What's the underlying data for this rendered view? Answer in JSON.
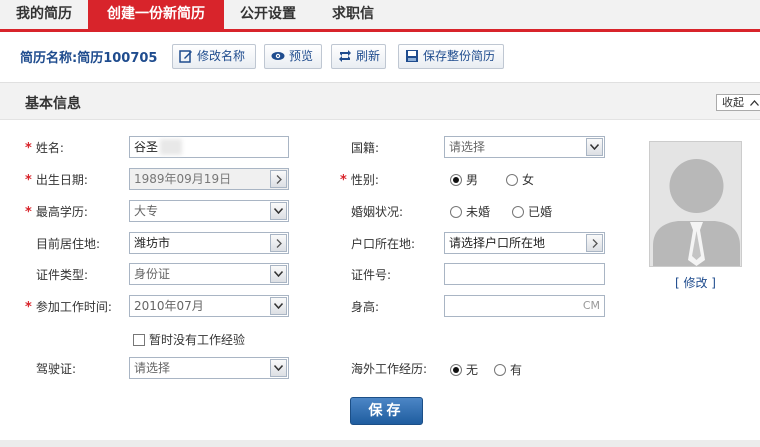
{
  "nav": {
    "tabs": [
      "我的简历",
      "创建一份新简历",
      "公开设置",
      "求职信"
    ],
    "active": 1
  },
  "resume": {
    "title": "简历名称:简历100705",
    "buttons": {
      "rename": "修改名称",
      "preview": "预览",
      "refresh": "刷新",
      "save_all": "保存整份简历"
    }
  },
  "section": {
    "title": "基本信息",
    "collapse": "收起"
  },
  "form": {
    "name_label": "姓名:",
    "name_value": "谷圣",
    "nationality_label": "国籍:",
    "nationality_value": "请选择",
    "birth_label": "出生日期:",
    "birth_value": "1989年09月19日",
    "gender_label": "性别:",
    "gender_options": [
      "男",
      "女"
    ],
    "gender_selected": 0,
    "education_label": "最高学历:",
    "education_value": "大专",
    "marital_label": "婚姻状况:",
    "marital_options": [
      "未婚",
      "已婚"
    ],
    "residence_label": "目前居住地:",
    "residence_value": "潍坊市",
    "hukou_label": "户口所在地:",
    "hukou_value": "请选择户口所在地",
    "id_type_label": "证件类型:",
    "id_type_value": "身份证",
    "id_number_label": "证件号:",
    "id_number_value": "",
    "work_start_label": "参加工作时间:",
    "work_start_value": "2010年07月",
    "height_label": "身高:",
    "height_unit": "CM",
    "no_experience_label": "暂时没有工作经验",
    "license_label": "驾驶证:",
    "license_value": "请选择",
    "overseas_label": "海外工作经历:",
    "overseas_options": [
      "无",
      "有"
    ],
    "overseas_selected": 0
  },
  "photo": {
    "edit_label": "[ 修改 ]"
  },
  "save_label": "保存",
  "colors": {
    "brand_red": "#d8242b",
    "link_blue": "#1f4c8e",
    "save_blue": "#2b6cb0"
  }
}
